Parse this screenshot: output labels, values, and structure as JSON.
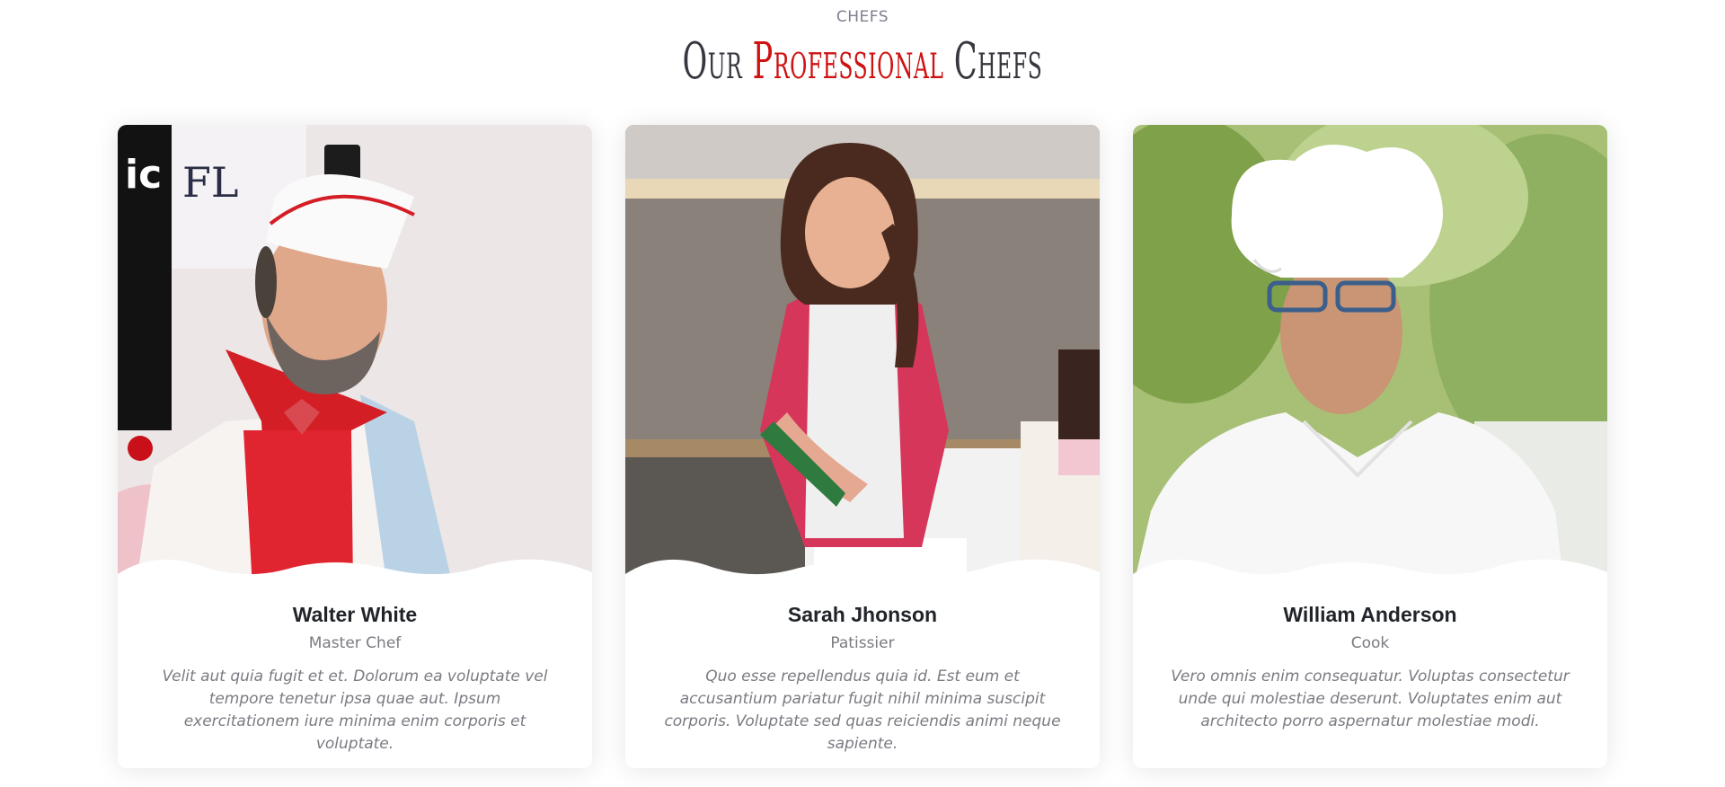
{
  "header": {
    "eyebrow": "CHEFS",
    "title_prefix": "Our",
    "title_accent": "Professional",
    "title_suffix": "Chefs",
    "accent_color": "#ce1212"
  },
  "chefs": [
    {
      "name": "Walter White",
      "role": "Master Chef",
      "bio": "Velit aut quia fugit et et. Dolorum ea voluptate vel tempore tenetur ipsa quae aut. Ipsum exercitationem iure minima enim corporis et voluptate."
    },
    {
      "name": "Sarah Jhonson",
      "role": "Patissier",
      "bio": "Quo esse repellendus quia id. Est eum et accusantium pariatur fugit nihil minima suscipit corporis. Voluptate sed quas reiciendis animi neque sapiente."
    },
    {
      "name": "William Anderson",
      "role": "Cook",
      "bio": "Vero omnis enim consequatur. Voluptas consectetur unde qui molestiae deserunt. Voluptates enim aut architecto porro aspernatur molestiae modi."
    }
  ]
}
